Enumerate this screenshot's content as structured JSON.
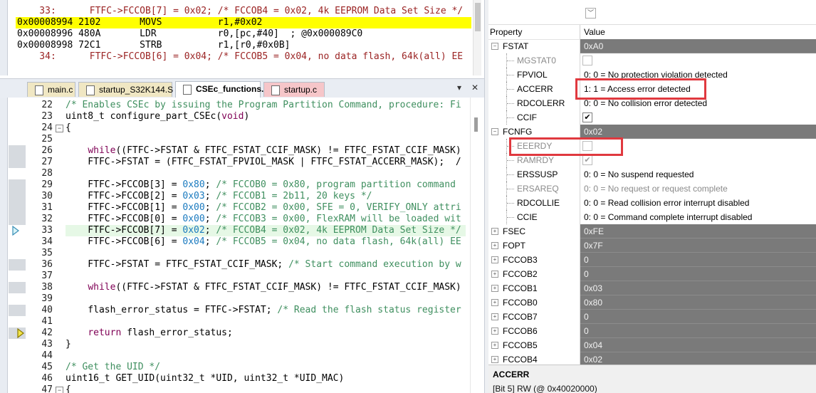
{
  "disassembly": {
    "lines": [
      "    33:      FTFC->FCCOB[7] = 0x02; /* FCCOB4 = 0x02, 4k EEPROM Data Set Size */",
      "0x00008994 2102       MOVS          r1,#0x02",
      "0x00008996 480A       LDR           r0,[pc,#40]  ; @0x000089C0",
      "0x00008998 72C1       STRB          r1,[r0,#0x0B]",
      "    34:      FTFC->FCCOB[6] = 0x04; /* FCCOB5 = 0x04, no data flash, 64k(all) EE"
    ]
  },
  "tabs": [
    {
      "label": "main.c",
      "active": false
    },
    {
      "label": "startup_S32K144.S",
      "active": false
    },
    {
      "label": "CSEc_functions.c",
      "active": true
    },
    {
      "label": "startup.c",
      "active": false
    }
  ],
  "tab_controls": {
    "dropdown": "▾",
    "close": "✕"
  },
  "editor": {
    "lines": [
      {
        "n": "22",
        "t": "/* Enables CSEc by issuing the Program Partition Command, procedure: Fi"
      },
      {
        "n": "23",
        "t": "uint8_t configure_part_CSEc(void)"
      },
      {
        "n": "24",
        "t": "{"
      },
      {
        "n": "25",
        "t": ""
      },
      {
        "n": "26",
        "t": "    while((FTFC->FSTAT & FTFC_FSTAT_CCIF_MASK) != FTFC_FSTAT_CCIF_MASK)"
      },
      {
        "n": "27",
        "t": "    FTFC->FSTAT = (FTFC_FSTAT_FPVIOL_MASK | FTFC_FSTAT_ACCERR_MASK);  /"
      },
      {
        "n": "28",
        "t": ""
      },
      {
        "n": "29",
        "t": "    FTFC->FCCOB[3] = 0x80; /* FCCOB0 = 0x80, program partition command"
      },
      {
        "n": "30",
        "t": "    FTFC->FCCOB[2] = 0x03; /* FCCOB1 = 2b11, 20 keys */"
      },
      {
        "n": "31",
        "t": "    FTFC->FCCOB[1] = 0x00; /* FCCOB2 = 0x00, SFE = 0, VERIFY_ONLY attri"
      },
      {
        "n": "32",
        "t": "    FTFC->FCCOB[0] = 0x00; /* FCCOB3 = 0x00, FlexRAM will be loaded wit"
      },
      {
        "n": "33",
        "t": "    FTFC->FCCOB[7] = 0x02; /* FCCOB4 = 0x02, 4k EEPROM Data Set Size */"
      },
      {
        "n": "34",
        "t": "    FTFC->FCCOB[6] = 0x04; /* FCCOB5 = 0x04, no data flash, 64k(all) EE"
      },
      {
        "n": "35",
        "t": ""
      },
      {
        "n": "36",
        "t": "    FTFC->FSTAT = FTFC_FSTAT_CCIF_MASK; /* Start command execution by w"
      },
      {
        "n": "37",
        "t": ""
      },
      {
        "n": "38",
        "t": "    while((FTFC->FSTAT & FTFC_FSTAT_CCIF_MASK) != FTFC_FSTAT_CCIF_MASK)"
      },
      {
        "n": "39",
        "t": ""
      },
      {
        "n": "40",
        "t": "    flash_error_status = FTFC->FSTAT; /* Read the flash status register"
      },
      {
        "n": "41",
        "t": ""
      },
      {
        "n": "42",
        "t": "    return flash_error_status;"
      },
      {
        "n": "43",
        "t": "}"
      },
      {
        "n": "44",
        "t": ""
      },
      {
        "n": "45",
        "t": "/* Get the UID */"
      },
      {
        "n": "46",
        "t": "uint16_t GET_UID(uint32_t *UID, uint32_t *UID_MAC)"
      },
      {
        "n": "47",
        "t": "{"
      }
    ]
  },
  "registers": {
    "header": {
      "property": "Property",
      "value": "Value"
    },
    "rows": [
      {
        "name": "FSTAT",
        "value": "0xA0",
        "group": true,
        "expanded": true
      },
      {
        "name": "MGSTAT0",
        "value": "",
        "check": "",
        "disabled": true
      },
      {
        "name": "FPVIOL",
        "value": "0: 0 = No protection violation detected"
      },
      {
        "name": "ACCERR",
        "value": "1: 1 = Access error detected"
      },
      {
        "name": "RDCOLERR",
        "value": "0: 0 = No collision error detected"
      },
      {
        "name": "CCIF",
        "value": "",
        "check": "✔"
      },
      {
        "name": "FCNFG",
        "value": "0x02",
        "group": true,
        "expanded": true
      },
      {
        "name": "EEERDY",
        "value": "",
        "check": "",
        "disabled": true
      },
      {
        "name": "RAMRDY",
        "value": "",
        "check": "✔",
        "disabled": true
      },
      {
        "name": "ERSSUSP",
        "value": "0: 0 = No suspend requested"
      },
      {
        "name": "ERSAREQ",
        "value": "0: 0 = No request or request complete",
        "disabled": true
      },
      {
        "name": "RDCOLLIE",
        "value": "0: 0 = Read collision error interrupt disabled"
      },
      {
        "name": "CCIE",
        "value": "0: 0 = Command complete interrupt disabled"
      },
      {
        "name": "FSEC",
        "value": "0xFE",
        "group": true
      },
      {
        "name": "FOPT",
        "value": "0x7F",
        "group": true
      },
      {
        "name": "FCCOB3",
        "value": "0",
        "group": true
      },
      {
        "name": "FCCOB2",
        "value": "0",
        "group": true
      },
      {
        "name": "FCCOB1",
        "value": "0x03",
        "group": true
      },
      {
        "name": "FCCOB0",
        "value": "0x80",
        "group": true
      },
      {
        "name": "FCCOB7",
        "value": "0",
        "group": true
      },
      {
        "name": "FCCOB6",
        "value": "0",
        "group": true
      },
      {
        "name": "FCCOB5",
        "value": "0x04",
        "group": true
      },
      {
        "name": "FCCOB4",
        "value": "0x02",
        "group": true
      }
    ],
    "info": {
      "title": "ACCERR",
      "detail": "[Bit 5] RW (@ 0x40020000)"
    },
    "colors": {
      "group_bg": "#7a7a7a",
      "highlight_box": "#e0393f"
    }
  }
}
